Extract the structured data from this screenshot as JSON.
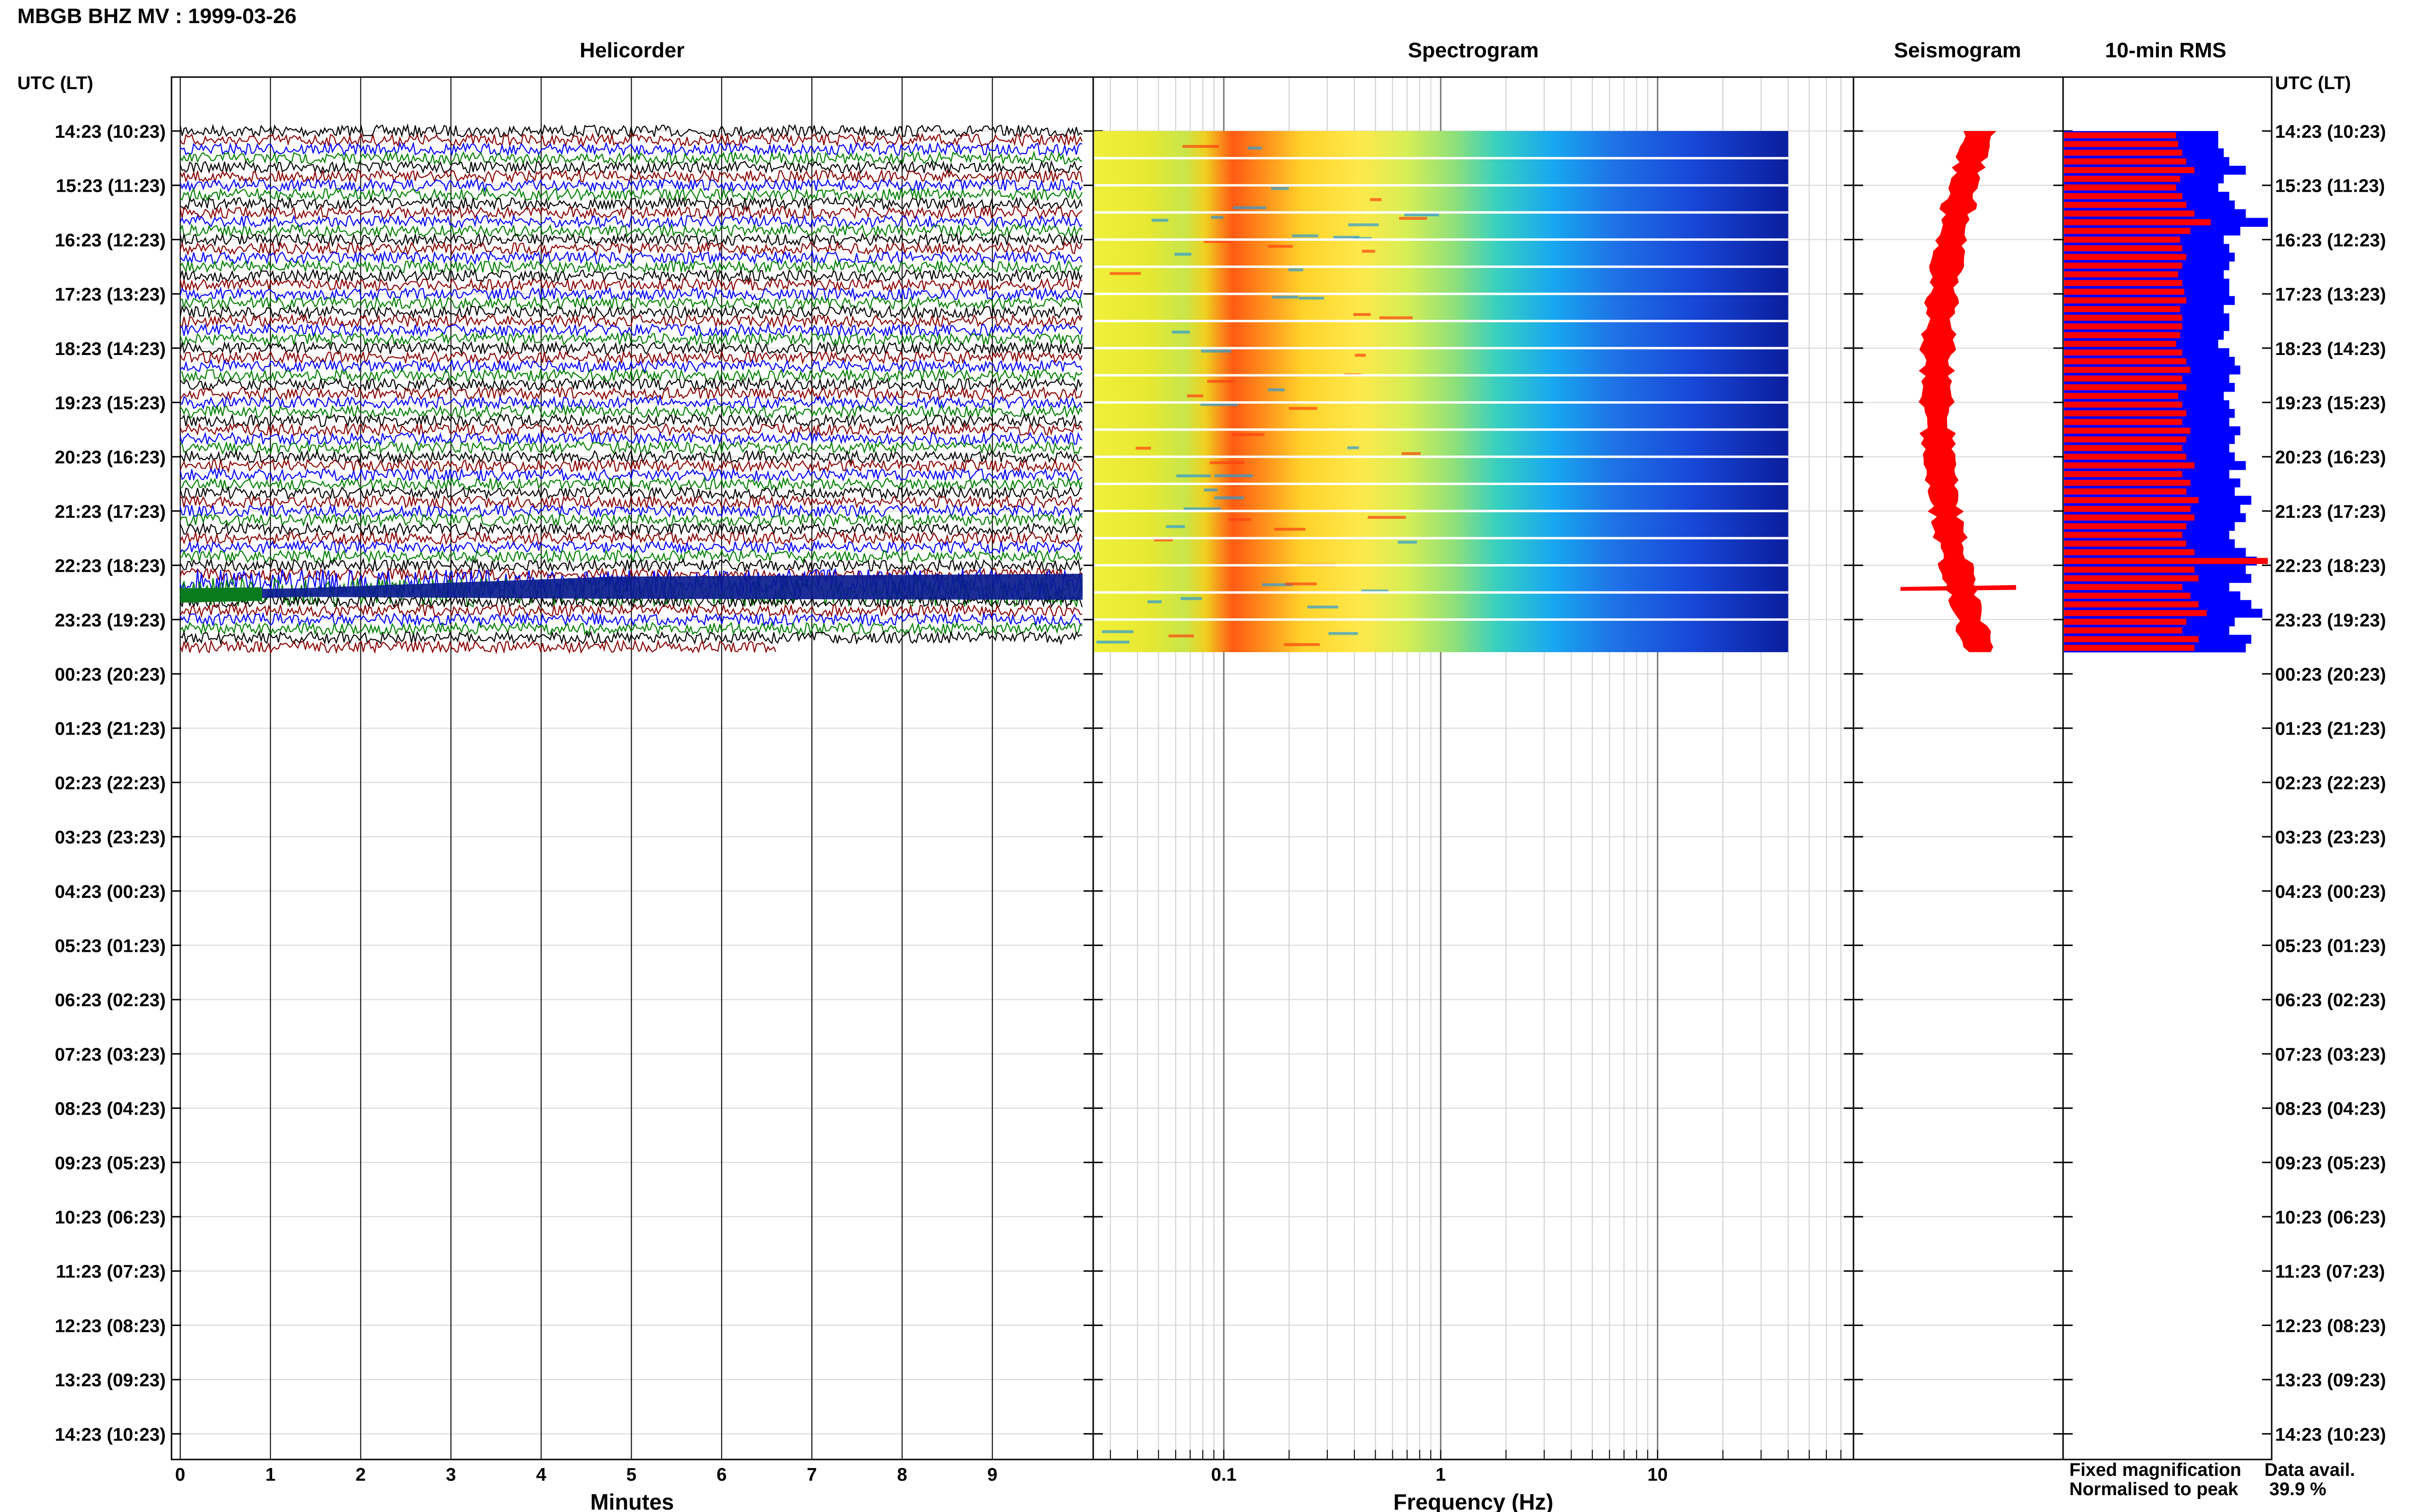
{
  "title": "MBGB BHZ MV : 1999-03-26",
  "headers": {
    "helicorder": "Helicorder",
    "spectrogram": "Spectrogram",
    "seismogram": "Seismogram",
    "rms": "10-min RMS",
    "utc_left": "UTC (LT)",
    "utc_right": "UTC (LT)"
  },
  "time_labels": [
    "14:23 (10:23)",
    "15:23 (11:23)",
    "16:23 (12:23)",
    "17:23 (13:23)",
    "18:23 (14:23)",
    "19:23 (15:23)",
    "20:23 (16:23)",
    "21:23 (17:23)",
    "22:23 (18:23)",
    "23:23 (19:23)",
    "00:23 (20:23)",
    "01:23 (21:23)",
    "02:23 (22:23)",
    "03:23 (23:23)",
    "04:23 (00:23)",
    "05:23 (01:23)",
    "06:23 (02:23)",
    "07:23 (03:23)",
    "08:23 (04:23)",
    "09:23 (05:23)",
    "10:23 (06:23)",
    "11:23 (07:23)",
    "12:23 (08:23)",
    "13:23 (09:23)",
    "14:23 (10:23)"
  ],
  "helicorder": {
    "xlabel": "Minutes",
    "ticks": [
      "0",
      "1",
      "2",
      "3",
      "4",
      "5",
      "6",
      "7",
      "8",
      "9"
    ],
    "xlim": [
      0,
      10
    ],
    "trace_colors": [
      "#000000",
      "#8b0000",
      "#0000ff",
      "#008000"
    ],
    "data_hours": 9.6,
    "event_hour": 8.4
  },
  "spectrogram": {
    "xlabel": "Frequency (Hz)",
    "scale": "log",
    "xlim": [
      0.025,
      80
    ],
    "ticks": [
      "0.1",
      "1",
      "10"
    ],
    "tick_values": [
      0.1,
      1,
      10
    ],
    "data_fmax": 40
  },
  "legend": {
    "fixed": "Fixed magnification",
    "normalised": "Normalised to peak",
    "fixed_color": "#0000ff",
    "normalised_color": "#ff0000"
  },
  "data_avail": {
    "label": "Data avail.",
    "value": "39.9 %"
  },
  "chart_data": {
    "type": "heatmap",
    "title": "MBGB BHZ MV : 1999-03-26",
    "data_availability_percent": 39.9,
    "rms_10min": {
      "fixed_magnification": [
        28,
        28,
        29,
        30,
        33,
        29,
        28,
        30,
        31,
        33,
        37,
        32,
        29,
        30,
        31,
        30,
        29,
        30,
        30,
        31,
        29,
        30,
        30,
        29,
        28,
        30,
        31,
        32,
        30,
        31,
        29,
        30,
        31,
        30,
        32,
        31,
        30,
        31,
        33,
        30,
        32,
        31,
        34,
        32,
        33,
        31,
        30,
        31,
        33,
        35,
        33,
        34,
        30,
        32,
        34,
        36,
        31,
        30,
        34,
        33
      ],
      "normalised_to_peak": [
        55,
        56,
        58,
        60,
        64,
        57,
        55,
        58,
        60,
        64,
        72,
        62,
        57,
        58,
        60,
        58,
        56,
        58,
        59,
        60,
        57,
        58,
        58,
        57,
        55,
        58,
        60,
        62,
        58,
        60,
        56,
        58,
        60,
        58,
        62,
        60,
        58,
        60,
        64,
        58,
        62,
        60,
        66,
        62,
        64,
        60,
        58,
        60,
        64,
        100,
        64,
        66,
        58,
        62,
        66,
        70,
        60,
        58,
        66,
        64
      ]
    }
  }
}
